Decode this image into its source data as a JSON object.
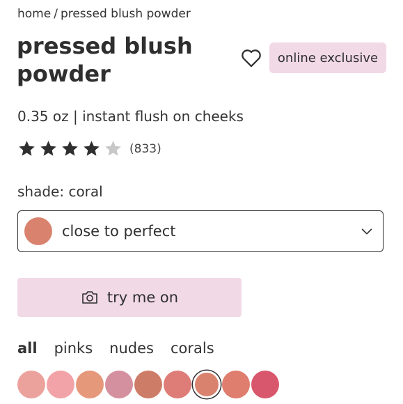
{
  "breadcrumb": {
    "home": "home",
    "separator": "/",
    "current": "pressed blush powder"
  },
  "product": {
    "title": "pressed blush powder",
    "badge": "online exclusive",
    "subtitle": "0.35 oz | instant flush on cheeks",
    "rating": {
      "stars": 4,
      "max": 5,
      "review_count": "(833)"
    }
  },
  "shade": {
    "label": "shade: coral",
    "selected_value": "close to perfect",
    "selected_color": "#d9836f"
  },
  "try_on": {
    "label": "try me on"
  },
  "filters": [
    {
      "label": "all",
      "active": true
    },
    {
      "label": "pinks",
      "active": false
    },
    {
      "label": "nudes",
      "active": false
    },
    {
      "label": "corals",
      "active": false
    }
  ],
  "swatches": [
    {
      "color": "#eba29d",
      "selected": false
    },
    {
      "color": "#f2a3a7",
      "selected": false
    },
    {
      "color": "#e6987b",
      "selected": false
    },
    {
      "color": "#d5909f",
      "selected": false
    },
    {
      "color": "#cd7c68",
      "selected": false
    },
    {
      "color": "#de7d78",
      "selected": false
    },
    {
      "color": "#d9836f",
      "selected": true
    },
    {
      "color": "#df7d6e",
      "selected": false
    },
    {
      "color": "#d9576c",
      "selected": false
    }
  ],
  "colors": {
    "accent_pink": "#f1d9e6",
    "star_filled": "#2f2f2f",
    "star_empty": "#c8c8c8"
  }
}
